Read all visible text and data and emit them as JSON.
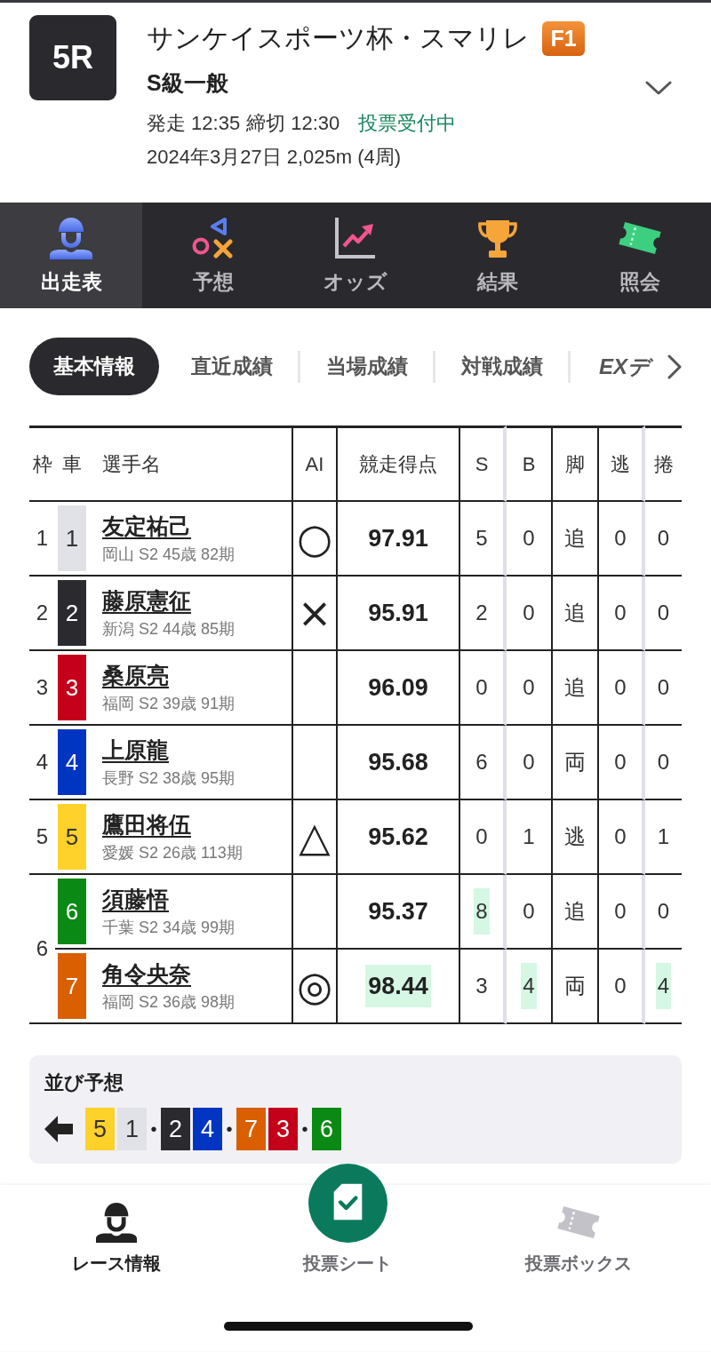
{
  "race": {
    "number": "5R",
    "title": "サンケイスポーツ杯・スマリレ",
    "grade": "F1",
    "class": "S級一般",
    "start": "発走 12:35",
    "deadline": "締切 12:30",
    "status": "投票受付中",
    "info": "2024年3月27日 2,025m (4周)"
  },
  "tabs": [
    {
      "label": "出走表",
      "kind": "entries",
      "selected": true
    },
    {
      "label": "予想",
      "kind": "forecast",
      "selected": false
    },
    {
      "label": "オッズ",
      "kind": "odds",
      "selected": false
    },
    {
      "label": "結果",
      "kind": "results",
      "selected": false
    },
    {
      "label": "照会",
      "kind": "inquiry",
      "selected": false
    }
  ],
  "subtabs": [
    {
      "label": "基本情報",
      "kind": "text",
      "selected": true
    },
    {
      "label": "直近成績",
      "kind": "text",
      "selected": false
    },
    {
      "label": "当場成績",
      "kind": "text",
      "selected": false
    },
    {
      "label": "対戦成績",
      "kind": "text",
      "selected": false
    },
    {
      "label": "EXデ",
      "kind": "logo",
      "selected": false
    }
  ],
  "table": {
    "columns": [
      "枠",
      "車",
      "選手名",
      "AI",
      "競走得点",
      "S",
      "B",
      "脚",
      "逃",
      "捲"
    ],
    "frames": [
      {
        "frame": "1",
        "riders": [
          {
            "car": "1",
            "color": "#e1e2e7",
            "name": "友定祐己",
            "info": "岡山 S2 45歳 82期",
            "ai": "○",
            "stats": [
              {
                "value": "97.91",
                "highlighted": false
              },
              {
                "value": "5",
                "highlighted": false
              },
              {
                "value": "0",
                "highlighted": false
              },
              {
                "value": "追",
                "highlighted": false
              },
              {
                "value": "0",
                "highlighted": false
              },
              {
                "value": "0",
                "highlighted": false
              }
            ]
          }
        ]
      },
      {
        "frame": "2",
        "riders": [
          {
            "car": "2",
            "color": "#2a2a2f",
            "name": "藤原憲征",
            "info": "新潟 S2 44歳 85期",
            "ai": "×",
            "stats": [
              {
                "value": "95.91",
                "highlighted": false
              },
              {
                "value": "2",
                "highlighted": false
              },
              {
                "value": "0",
                "highlighted": false
              },
              {
                "value": "追",
                "highlighted": false
              },
              {
                "value": "0",
                "highlighted": false
              },
              {
                "value": "0",
                "highlighted": false
              }
            ]
          }
        ]
      },
      {
        "frame": "3",
        "riders": [
          {
            "car": "3",
            "color": "#c4001b",
            "name": "桑原亮",
            "info": "福岡 S2 39歳 91期",
            "stats": [
              {
                "value": "96.09",
                "highlighted": false
              },
              {
                "value": "0",
                "highlighted": false
              },
              {
                "value": "0",
                "highlighted": false
              },
              {
                "value": "追",
                "highlighted": false
              },
              {
                "value": "0",
                "highlighted": false
              },
              {
                "value": "0",
                "highlighted": false
              }
            ]
          }
        ]
      },
      {
        "frame": "4",
        "riders": [
          {
            "car": "4",
            "color": "#0035c2",
            "name": "上原龍",
            "info": "長野 S2 38歳 95期",
            "stats": [
              {
                "value": "95.68",
                "highlighted": false
              },
              {
                "value": "6",
                "highlighted": false
              },
              {
                "value": "0",
                "highlighted": false
              },
              {
                "value": "両",
                "highlighted": false
              },
              {
                "value": "0",
                "highlighted": false
              },
              {
                "value": "0",
                "highlighted": false
              }
            ]
          }
        ]
      },
      {
        "frame": "5",
        "riders": [
          {
            "car": "5",
            "color": "#ffd12b",
            "name": "鷹田将伍",
            "info": "愛媛 S2 26歳 113期",
            "ai": "△",
            "stats": [
              {
                "value": "95.62",
                "highlighted": false
              },
              {
                "value": "0",
                "highlighted": false
              },
              {
                "value": "1",
                "highlighted": false
              },
              {
                "value": "逃",
                "highlighted": false
              },
              {
                "value": "0",
                "highlighted": false
              },
              {
                "value": "1",
                "highlighted": false
              }
            ]
          }
        ]
      },
      {
        "frame": "6",
        "riders": [
          {
            "car": "6",
            "color": "#0a8a14",
            "name": "須藤悟",
            "info": "千葉 S2 34歳 99期",
            "stats": [
              {
                "value": "95.37",
                "highlighted": false
              },
              {
                "value": "8",
                "highlighted": true
              },
              {
                "value": "0",
                "highlighted": false
              },
              {
                "value": "追",
                "highlighted": false
              },
              {
                "value": "0",
                "highlighted": false
              },
              {
                "value": "0",
                "highlighted": false
              }
            ]
          },
          {
            "car": "7",
            "color": "#d95f00",
            "name": "角令央奈",
            "info": "福岡 S2 36歳 98期",
            "ai": "◎",
            "stats": [
              {
                "value": "98.44",
                "highlighted": true
              },
              {
                "value": "3",
                "highlighted": false
              },
              {
                "value": "4",
                "highlighted": true
              },
              {
                "value": "両",
                "highlighted": false
              },
              {
                "value": "0",
                "highlighted": false
              },
              {
                "value": "4",
                "highlighted": true
              }
            ]
          }
        ]
      }
    ]
  },
  "prediction": {
    "title": "並び予想",
    "groups": [
      {
        "cars": [
          {
            "car": "5",
            "color": "#ffd12b"
          },
          {
            "car": "1",
            "color": "#e1e2e7"
          }
        ],
        "separator": "•"
      },
      {
        "cars": [
          {
            "car": "2",
            "color": "#2a2a2f"
          },
          {
            "car": "4",
            "color": "#0035c2"
          }
        ],
        "separator": "•"
      },
      {
        "cars": [
          {
            "car": "7",
            "color": "#d95f00"
          },
          {
            "car": "3",
            "color": "#c4001b"
          }
        ],
        "separator": "•"
      },
      {
        "cars": [
          {
            "car": "6",
            "color": "#0a8a14"
          }
        ]
      }
    ]
  },
  "bottom_nav": [
    {
      "label": "レース情報",
      "kind": "race",
      "selected": true
    },
    {
      "label": "投票シート",
      "kind": "sheet",
      "selected": false
    },
    {
      "label": "投票ボックス",
      "kind": "box",
      "selected": false
    }
  ]
}
